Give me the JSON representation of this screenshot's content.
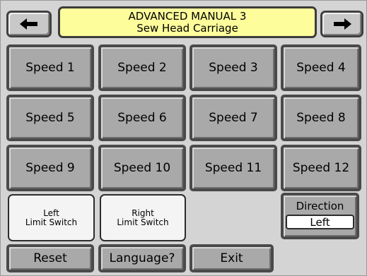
{
  "header": {
    "title": "ADVANCED MANUAL 3",
    "subtitle": "Sew Head Carriage"
  },
  "nav": {
    "prev_icon": "left-arrow-icon",
    "next_icon": "right-arrow-icon"
  },
  "speeds": [
    {
      "label": "Speed 1"
    },
    {
      "label": "Speed 2"
    },
    {
      "label": "Speed 3"
    },
    {
      "label": "Speed 4"
    },
    {
      "label": "Speed 5"
    },
    {
      "label": "Speed 6"
    },
    {
      "label": "Speed 7"
    },
    {
      "label": "Speed 8"
    },
    {
      "label": "Speed 9"
    },
    {
      "label": "Speed 10"
    },
    {
      "label": "Speed 11"
    },
    {
      "label": "Speed 12"
    }
  ],
  "limits": {
    "left": {
      "line1": "Left",
      "line2": "Limit Switch"
    },
    "right": {
      "line1": "Right",
      "line2": "Limit Switch"
    }
  },
  "direction": {
    "label": "Direction",
    "value": "Left"
  },
  "footer": {
    "reset": "Reset",
    "language": "Language?",
    "exit": "Exit"
  },
  "colors": {
    "header_bg": "#fdfd9c",
    "button_bg": "#a9a9a9",
    "light_button_bg": "#f4f4f4"
  }
}
